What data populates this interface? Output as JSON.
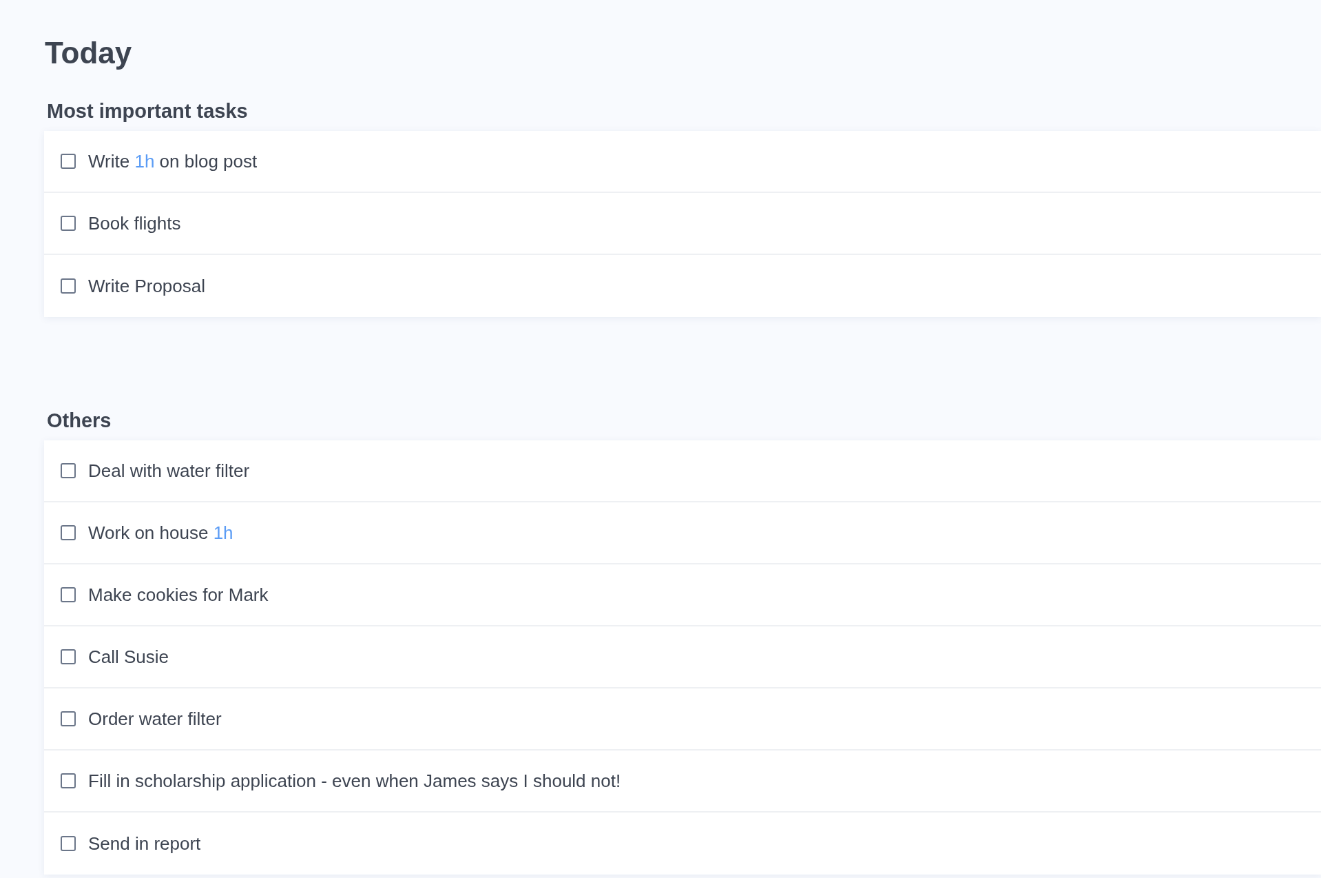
{
  "title": "Today",
  "sections": [
    {
      "heading": "Most important tasks",
      "tasks": [
        {
          "checked": false,
          "segments": [
            {
              "kind": "plain",
              "text": "Write"
            },
            {
              "kind": "duration",
              "text": "1h"
            },
            {
              "kind": "plain",
              "text": "on blog post"
            }
          ]
        },
        {
          "checked": false,
          "segments": [
            {
              "kind": "plain",
              "text": "Book flights"
            }
          ]
        },
        {
          "checked": false,
          "segments": [
            {
              "kind": "plain",
              "text": "Write Proposal"
            }
          ]
        }
      ]
    },
    {
      "heading": "Others",
      "tasks": [
        {
          "checked": false,
          "segments": [
            {
              "kind": "plain",
              "text": "Deal with water filter"
            }
          ]
        },
        {
          "checked": false,
          "segments": [
            {
              "kind": "plain",
              "text": "Work on house"
            },
            {
              "kind": "duration",
              "text": "1h"
            }
          ]
        },
        {
          "checked": false,
          "segments": [
            {
              "kind": "plain",
              "text": "Make cookies for Mark"
            }
          ]
        },
        {
          "checked": false,
          "segments": [
            {
              "kind": "plain",
              "text": "Call Susie"
            }
          ]
        },
        {
          "checked": false,
          "segments": [
            {
              "kind": "plain",
              "text": "Order water filter"
            }
          ]
        },
        {
          "checked": false,
          "segments": [
            {
              "kind": "plain",
              "text": "Fill in scholarship application - even when James says I should not!"
            }
          ]
        },
        {
          "checked": false,
          "segments": [
            {
              "kind": "plain",
              "text": "Send in report"
            }
          ]
        }
      ]
    }
  ]
}
